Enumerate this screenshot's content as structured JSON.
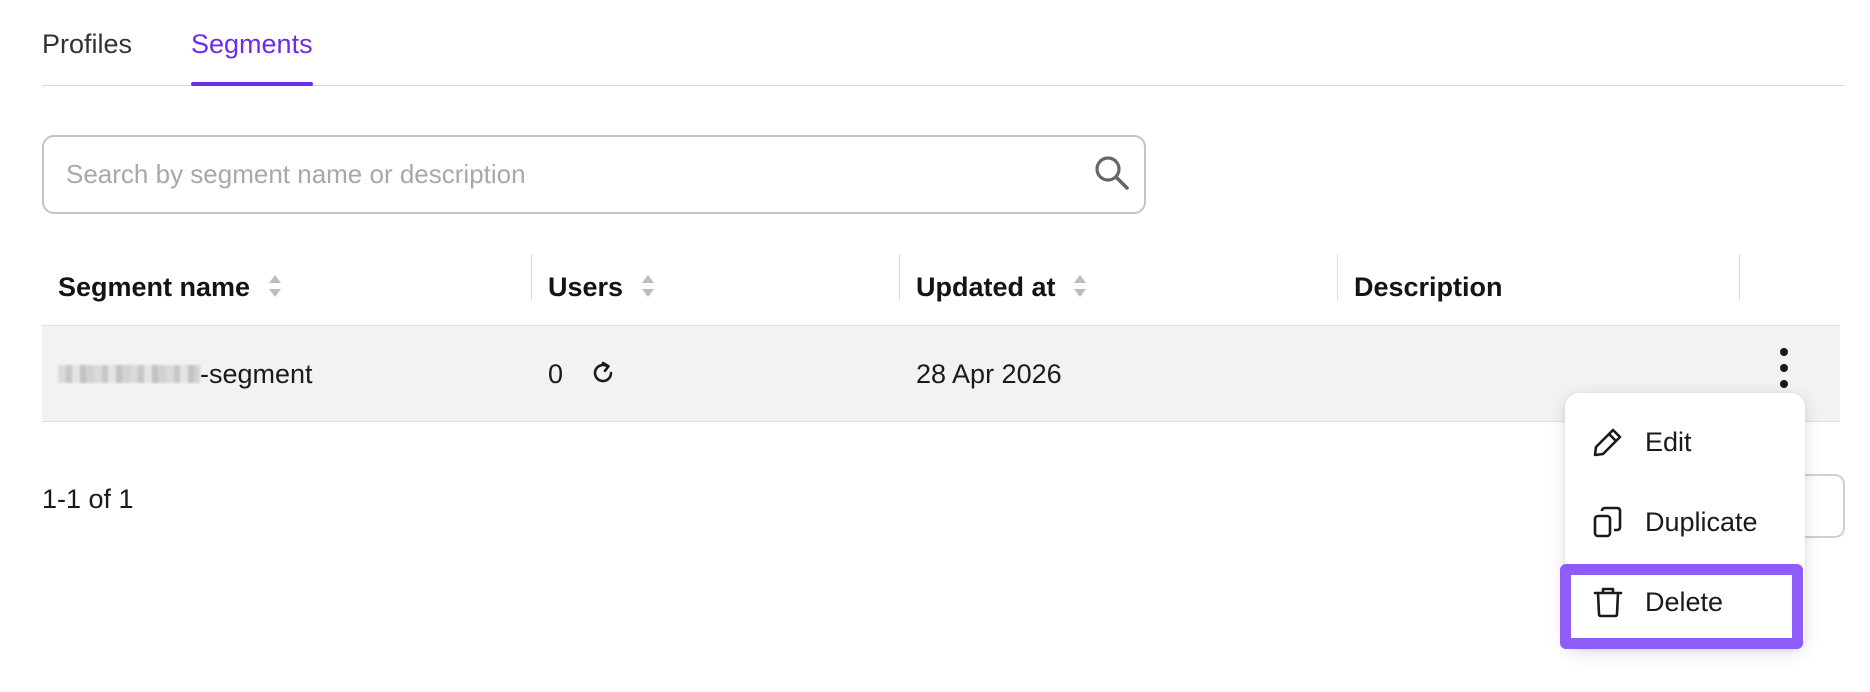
{
  "tabs": {
    "profiles": "Profiles",
    "segments": "Segments"
  },
  "search": {
    "placeholder": "Search by segment name or description",
    "value": ""
  },
  "table": {
    "headers": {
      "name": "Segment name",
      "users": "Users",
      "updated": "Updated at",
      "description": "Description"
    },
    "rows": [
      {
        "name_suffix": "-segment",
        "users": "0",
        "updated": "28 Apr 2026",
        "description": ""
      }
    ]
  },
  "pagination": {
    "summary": "1-1 of 1"
  },
  "menu": {
    "edit": "Edit",
    "duplicate": "Duplicate",
    "delete": "Delete"
  },
  "colors": {
    "accent": "#6a2ee8",
    "highlight": "#8e5cf8",
    "row_bg": "#f2f2f2"
  },
  "icons": [
    "search-icon",
    "sort-icon",
    "refresh-icon",
    "more-vertical-icon",
    "pencil-icon",
    "copy-icon",
    "trash-icon"
  ]
}
